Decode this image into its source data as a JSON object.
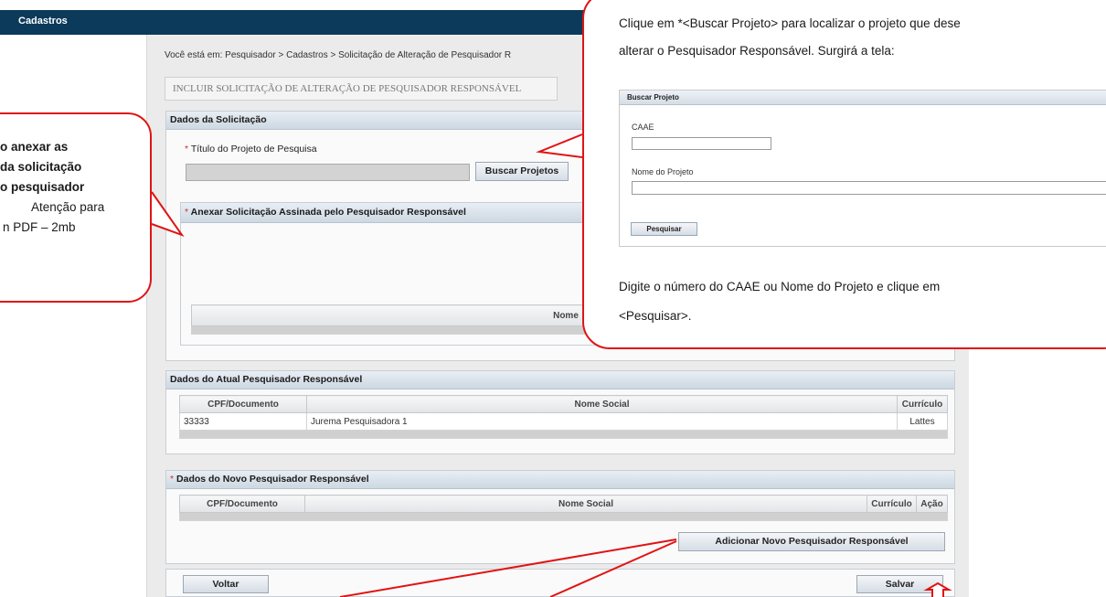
{
  "app": {
    "title": "Cadastros"
  },
  "breadcrumb": "Você está em: Pesquisador > Cadastros > Solicitação de Alteração de Pesquisador R",
  "page_heading": "INCLUIR SOLICITAÇÃO DE ALTERAÇÃO DE PESQUISADOR RESPONSÁVEL",
  "dados_solicitacao": {
    "header": "Dados da Solicitação",
    "titulo_label": "Título do Projeto de Pesquisa",
    "titulo_value": "",
    "buscar_button": "Buscar Projetos",
    "anexar": {
      "header": "Anexar Solicitação Assinada pelo Pesquisador Responsável",
      "column_nome": "Nome"
    }
  },
  "atual": {
    "header": "Dados do Atual Pesquisador Responsável",
    "columns": [
      "CPF/Documento",
      "Nome Social",
      "Currículo"
    ],
    "rows": [
      {
        "cpf": "33333",
        "nome": "Jurema Pesquisadora 1",
        "curriculo": "Lattes"
      }
    ]
  },
  "novo": {
    "header": "Dados do Novo Pesquisador Responsável",
    "columns": [
      "CPF/Documento",
      "Nome Social",
      "Currículo",
      "Ação"
    ],
    "add_button": "Adicionar Novo Pesquisador Responsável"
  },
  "footer": {
    "voltar": "Voltar",
    "salvar": "Salvar"
  },
  "required_mark": "*",
  "callout_left": {
    "line1": "o anexar as",
    "line2": "da solicitação",
    "line3": "o pesquisador",
    "line4": "Atenção para",
    "line5": "n PDF – 2mb"
  },
  "callout_right": {
    "line1": "Clique em *<Buscar Projeto> para localizar o projeto que dese",
    "line2": "alterar o Pesquisador Responsável. Surgirá a tela:",
    "line3": "Digite o número do CAAE ou Nome do Projeto e clique em",
    "line4": "<Pesquisar>.",
    "mini": {
      "header": "Buscar Projeto",
      "caae_label": "CAAE",
      "nome_label": "Nome do Projeto",
      "pesquisar": "Pesquisar"
    }
  },
  "colors": {
    "topbar": "#0b3a5a",
    "callout_border": "#e01414",
    "required": "#d03030"
  }
}
